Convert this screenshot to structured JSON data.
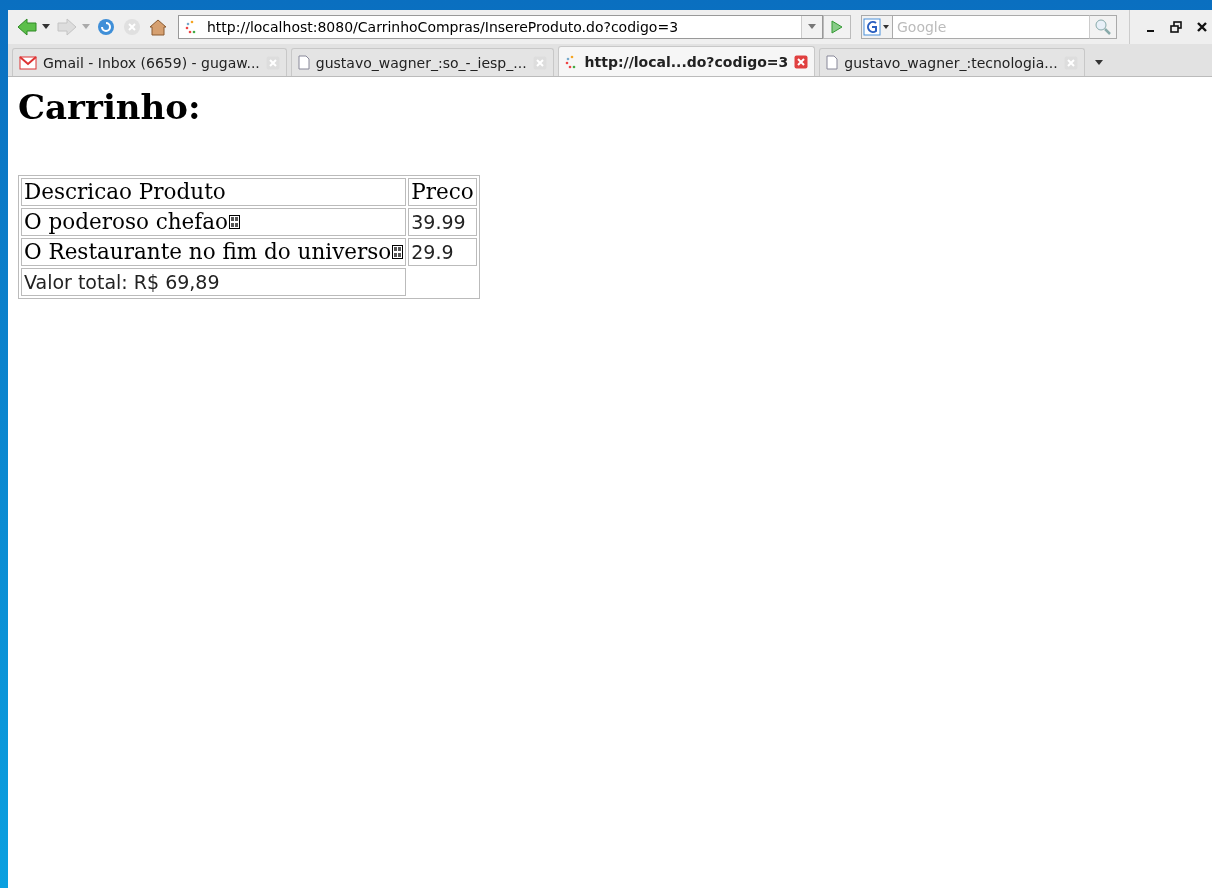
{
  "toolbar": {
    "url": "http://localhost:8080/CarrinhoCompras/InsereProduto.do?codigo=3",
    "search": {
      "placeholder": "Google"
    }
  },
  "tabs": [
    {
      "title": "Gmail - Inbox (6659) - gugaw...",
      "kind": "mail",
      "selected": false
    },
    {
      "title": "gustavo_wagner_:so_-_iesp_...",
      "kind": "page",
      "selected": false
    },
    {
      "title": "http://local...do?codigo=3",
      "kind": "loading",
      "selected": true
    },
    {
      "title": "gustavo_wagner_:tecnologia...",
      "kind": "page",
      "selected": false
    }
  ],
  "page": {
    "heading": "Carrinho:",
    "table": {
      "columns": [
        "Descricao Produto",
        "Preco"
      ],
      "rows": [
        {
          "description": "O poderoso chefao",
          "price": "39.99",
          "glyph": true
        },
        {
          "description": "O Restaurante no fim do universo",
          "price": "29.9",
          "glyph": true
        }
      ],
      "total": "Valor total: R$ 69,89"
    }
  }
}
